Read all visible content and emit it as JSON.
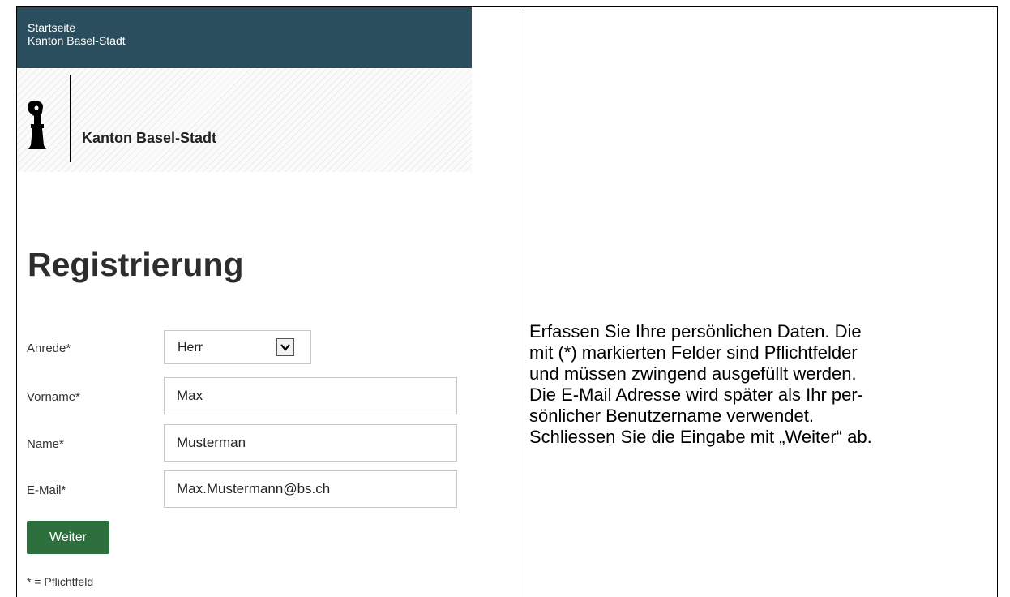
{
  "topbar": {
    "home_link": "Startseite",
    "site_name": "Kanton Basel-Stadt"
  },
  "logo": {
    "icon": "basel-staff-icon",
    "text": "Kanton Basel-Stadt"
  },
  "page": {
    "title": "Registrierung"
  },
  "form": {
    "salutation": {
      "label": "Anrede*",
      "selected": "Herr"
    },
    "first_name": {
      "label": "Vorname*",
      "value": "Max"
    },
    "last_name": {
      "label": "Name*",
      "value": "Musterman"
    },
    "email": {
      "label": "E-Mail*",
      "value": "Max.Mustermann@bs.ch"
    },
    "submit_label": "Weiter",
    "footnote": "* = Pflichtfeld"
  },
  "instructions": {
    "lines": [
      "Erfassen Sie Ihre persönlichen Daten. Die",
      "mit (*) markierten Felder sind Pflichtfelder",
      "und müssen zwingend ausgefüllt werden.",
      "Die E-Mail Adresse wird später als Ihr per-",
      "sönlicher Benutzername verwendet.",
      "Schliessen Sie die Eingabe mit „Weiter“ ab."
    ]
  },
  "colors": {
    "topbar_bg": "#2b4e5e",
    "button_bg": "#2e6f3e"
  }
}
